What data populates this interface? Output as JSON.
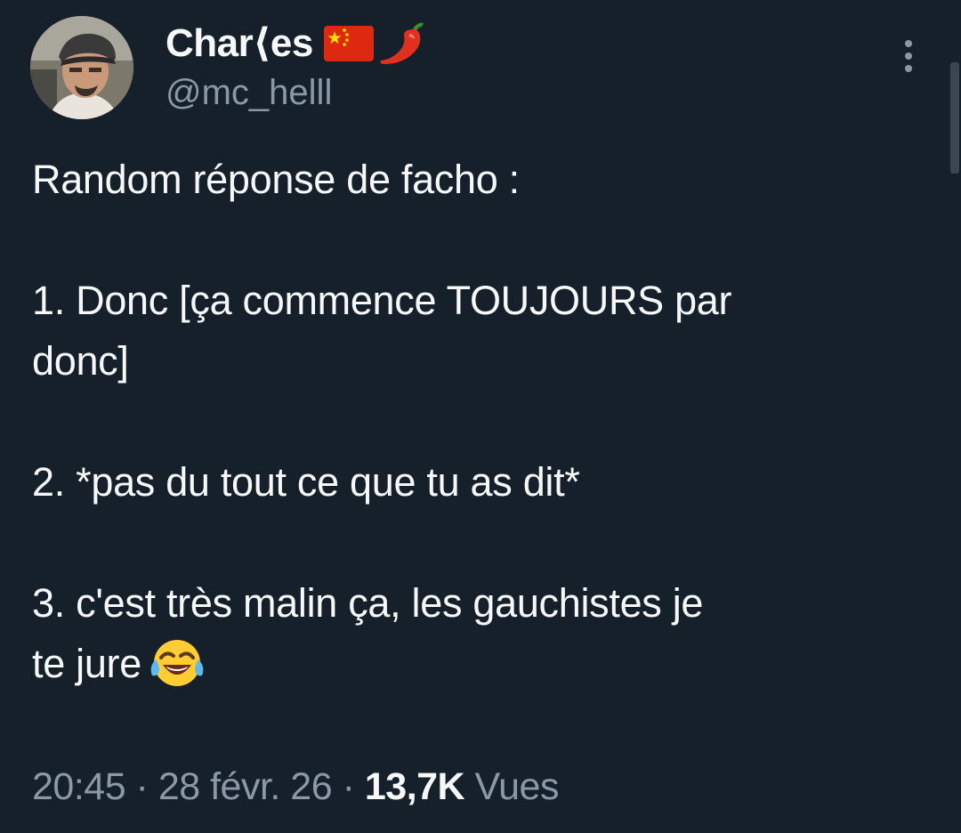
{
  "tweet": {
    "author": {
      "display_name": "Char⟨es",
      "flag_icon": "china-flag-icon",
      "pepper_icon": "hot-pepper-icon",
      "handle": "@mc_helll",
      "avatar_icon": "user-avatar"
    },
    "menu_icon": "more-options-icon",
    "lines": {
      "l1": "Random réponse de facho :",
      "l2": "1. Donc [ça commence TOUJOURS par",
      "l3": "donc]",
      "l4": "2. *pas du tout ce que tu as dit*",
      "l5": "3. c'est très malin ça, les gauchistes je",
      "l6": "te jure",
      "emoji": "face-with-tears-of-joy-icon"
    },
    "meta": {
      "time": "20:45",
      "sep1": " · ",
      "date": "28 févr. 26",
      "sep2": " · ",
      "views_count": "13,7K",
      "views_label": " Vues"
    }
  },
  "colors": {
    "background": "#15202b",
    "text_primary": "#f7f9f9",
    "text_secondary": "#8b98a5"
  }
}
